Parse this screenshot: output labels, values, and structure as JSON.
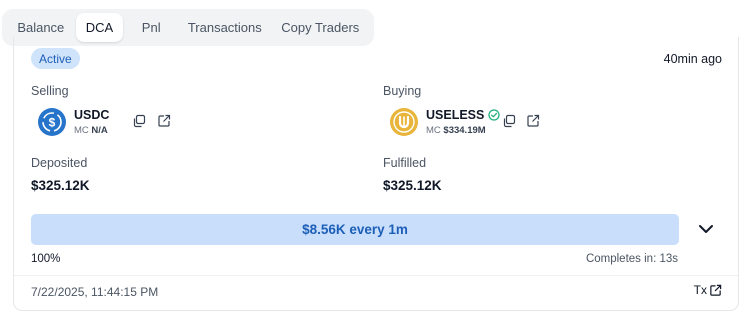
{
  "tabs": [
    {
      "label": "Balance"
    },
    {
      "label": "DCA",
      "active": true
    },
    {
      "label": "Pnl"
    },
    {
      "label": "Transactions"
    },
    {
      "label": "Copy Traders"
    }
  ],
  "order": {
    "status": "Active",
    "age": "40min ago",
    "selling": {
      "label": "Selling",
      "symbol": "USDC",
      "mc_label": "MC",
      "mc_value": "N/A",
      "logo_color": "#2775ca"
    },
    "buying": {
      "label": "Buying",
      "symbol": "USELESS",
      "verified": true,
      "mc_label": "MC",
      "mc_value": "$334.19M",
      "logo_color": "#e8b53a",
      "verified_color": "#22b07d"
    },
    "deposited": {
      "label": "Deposited",
      "value": "$325.12K"
    },
    "fulfilled": {
      "label": "Fulfilled",
      "value": "$325.12K"
    },
    "progress": {
      "text": "$8.56K every 1m",
      "percent_label": "100%",
      "percent": 100,
      "completes_label": "Completes in: 13s"
    },
    "created": "7/22/2025, 11:44:15 PM",
    "tx_label": "Tx"
  },
  "colors": {
    "accent": "#1d5fb8",
    "badge_bg": "#cfe3fb",
    "bar_bg": "#c8defa"
  },
  "icons": {
    "copy": "copy-icon",
    "external": "external-link-icon",
    "chevron": "chevron-down-icon",
    "verified": "check-circle-icon"
  }
}
